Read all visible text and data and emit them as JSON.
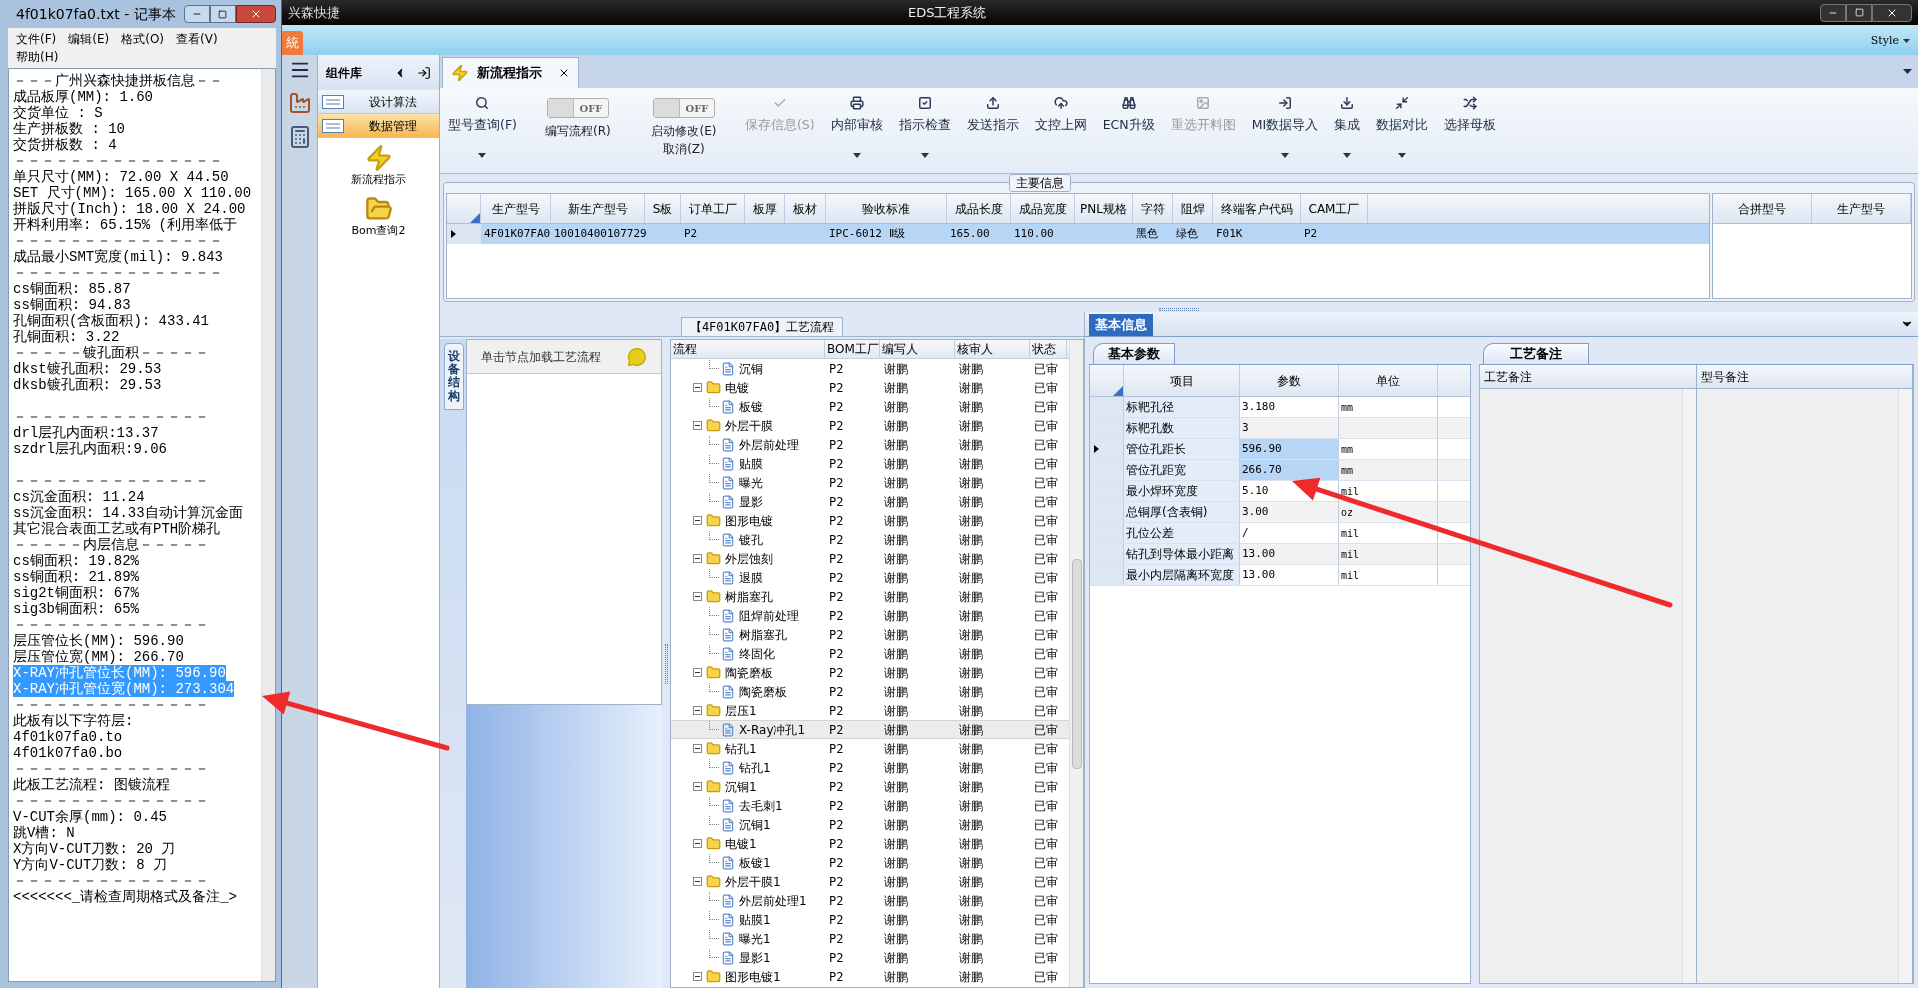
{
  "notepad": {
    "title": "4f01k07fa0.txt - 记事本",
    "menu": [
      "文件(F)",
      "编辑(E)",
      "格式(O)",
      "查看(V)",
      "帮助(H)"
    ],
    "lines": [
      {
        "kind": "text",
        "text": "－－－广州兴森快捷拼板信息－－",
        "selected": false
      },
      {
        "kind": "text",
        "text": "成品板厚(MM): 1.60",
        "selected": false
      },
      {
        "kind": "text",
        "text": "交货单位 : S",
        "selected": false
      },
      {
        "kind": "text",
        "text": "生产拼板数 : 10",
        "selected": false
      },
      {
        "kind": "text",
        "text": "交货拼板数 : 4",
        "selected": false
      },
      {
        "kind": "text",
        "text": "－－－－－－－－－－－－－－－",
        "selected": false
      },
      {
        "kind": "text",
        "text": "单只尺寸(MM): 72.00 X 44.50",
        "selected": false
      },
      {
        "kind": "text",
        "text": "SET 尺寸(MM): 165.00 X 110.00",
        "selected": false
      },
      {
        "kind": "text",
        "text": "拼版尺寸(Inch): 18.00 X 24.00",
        "selected": false
      },
      {
        "kind": "text",
        "text": "开料利用率: 65.15% (利用率低于",
        "selected": false
      },
      {
        "kind": "text",
        "text": "－－－－－－－－－－－－－－－",
        "selected": false
      },
      {
        "kind": "text",
        "text": "成品最小SMT宽度(mil): 9.843",
        "selected": false
      },
      {
        "kind": "text",
        "text": "－－－－－－－－－－－－－－－",
        "selected": false
      },
      {
        "kind": "text",
        "text": "cs铜面积: 85.87",
        "selected": false
      },
      {
        "kind": "text",
        "text": "ss铜面积: 94.83",
        "selected": false
      },
      {
        "kind": "text",
        "text": "孔铜面积(含板面积): 433.41",
        "selected": false
      },
      {
        "kind": "text",
        "text": "孔铜面积: 3.22",
        "selected": false
      },
      {
        "kind": "text",
        "text": "－－－－－镀孔面积－－－－－",
        "selected": false
      },
      {
        "kind": "text",
        "text": "dkst镀孔面积: 29.53",
        "selected": false
      },
      {
        "kind": "text",
        "text": "dksb镀孔面积: 29.53",
        "selected": false
      },
      {
        "kind": "blank"
      },
      {
        "kind": "text",
        "text": "－－－－－－－－－－－－－－",
        "selected": false
      },
      {
        "kind": "text",
        "text": "drl层孔内面积:13.37",
        "selected": false
      },
      {
        "kind": "text",
        "text": "szdrl层孔内面积:9.06",
        "selected": false
      },
      {
        "kind": "blank"
      },
      {
        "kind": "text",
        "text": "－－－－－－－－－－－－－－",
        "selected": false
      },
      {
        "kind": "text",
        "text": "cs沉金面积: 11.24",
        "selected": false
      },
      {
        "kind": "text",
        "text": "ss沉金面积: 14.33自动计算沉金面",
        "selected": false
      },
      {
        "kind": "text",
        "text": "其它混合表面工艺或有PTH阶梯孔",
        "selected": false
      },
      {
        "kind": "text",
        "text": "－－－－－内层信息－－－－－",
        "selected": false
      },
      {
        "kind": "text",
        "text": "cs铜面积: 19.82%",
        "selected": false
      },
      {
        "kind": "text",
        "text": "ss铜面积: 21.89%",
        "selected": false
      },
      {
        "kind": "text",
        "text": "sig2t铜面积: 67%",
        "selected": false
      },
      {
        "kind": "text",
        "text": "sig3b铜面积: 65%",
        "selected": false
      },
      {
        "kind": "text",
        "text": "－－－－－－－－－－－－－－",
        "selected": false
      },
      {
        "kind": "text",
        "text": "层压管位长(MM): 596.90",
        "selected": false
      },
      {
        "kind": "text",
        "text": "层压管位宽(MM): 266.70",
        "selected": false
      },
      {
        "kind": "text",
        "text": "X-RAY冲孔管位长(MM): 596.90",
        "selected": true
      },
      {
        "kind": "text",
        "text": "X-RAY冲孔管位宽(MM): 273.304",
        "selected": true
      },
      {
        "kind": "text",
        "text": "－－－－－－－－－－－－－－",
        "selected": false
      },
      {
        "kind": "text",
        "text": "此板有以下字符层:",
        "selected": false
      },
      {
        "kind": "text",
        "text": "4f01k07fa0.to",
        "selected": false
      },
      {
        "kind": "text",
        "text": "4f01k07fa0.bo",
        "selected": false
      },
      {
        "kind": "text",
        "text": "－－－－－－－－－－－－－－",
        "selected": false
      },
      {
        "kind": "text",
        "text": "此板工艺流程: 图镀流程",
        "selected": false
      },
      {
        "kind": "text",
        "text": "－－－－－－－－－－－－－－",
        "selected": false
      },
      {
        "kind": "text",
        "text": "V-CUT余厚(mm): 0.45",
        "selected": false
      },
      {
        "kind": "text",
        "text": "跳V槽: N",
        "selected": false
      },
      {
        "kind": "text",
        "text": "X方向V-CUT刀数: 20 刀",
        "selected": false
      },
      {
        "kind": "text",
        "text": "Y方向V-CUT刀数: 8 刀",
        "selected": false
      },
      {
        "kind": "text",
        "text": "－－－－－－－－－－－－－－",
        "selected": false
      },
      {
        "kind": "text",
        "text": "<<<<<<<_请检查周期格式及备注_>",
        "selected": false
      }
    ]
  },
  "app": {
    "title_left": "兴森快捷",
    "title": "EDS工程系统",
    "ribbon_tab": "統",
    "style_menu": "Style"
  },
  "component_panel": {
    "title": "组件库",
    "groups": [
      {
        "label": "设计算法",
        "selected": false
      },
      {
        "label": "数据管理",
        "selected": true
      }
    ],
    "items": [
      "新流程指示",
      "Bom查询2"
    ]
  },
  "tabs": [
    {
      "label": "新流程指示",
      "selected": true
    }
  ],
  "toolbar": [
    {
      "kind": "button",
      "label": "型号查询(F)",
      "dropdown": true,
      "disabled": false
    },
    {
      "kind": "toggle",
      "label": "编写流程(R)",
      "state_text": "OFF",
      "on": false
    },
    {
      "kind": "toggle",
      "label": "启动修改(E) 取消(Z)",
      "state_text": "OFF",
      "on": false
    },
    {
      "kind": "button",
      "label": "保存信息(S)",
      "dropdown": false,
      "disabled": true
    },
    {
      "kind": "button",
      "label": "内部审核",
      "dropdown": true,
      "disabled": false
    },
    {
      "kind": "button",
      "label": "指示检查",
      "dropdown": true,
      "disabled": false
    },
    {
      "kind": "button",
      "label": "发送指示",
      "dropdown": false,
      "disabled": false
    },
    {
      "kind": "button",
      "label": "文控上网",
      "dropdown": false,
      "disabled": false
    },
    {
      "kind": "button",
      "label": "ECN升级",
      "dropdown": false,
      "disabled": false
    },
    {
      "kind": "button",
      "label": "重选开料图",
      "dropdown": false,
      "disabled": true
    },
    {
      "kind": "button",
      "label": "MI数据导入",
      "dropdown": true,
      "disabled": false
    },
    {
      "kind": "button",
      "label": "集成",
      "dropdown": true,
      "disabled": false
    },
    {
      "kind": "button",
      "label": "数据对比",
      "dropdown": true,
      "disabled": false
    },
    {
      "kind": "button",
      "label": "选择母板",
      "dropdown": false,
      "disabled": false
    }
  ],
  "main_info": {
    "title": "主要信息",
    "columns": [
      "生产型号",
      "新生产型号",
      "S板",
      "订单工厂",
      "板厚",
      "板材",
      "验收标准",
      "成品长度",
      "成品宽度",
      "PNL规格",
      "字符",
      "阻焊",
      "终端客户代码",
      "CAM工厂"
    ],
    "rows": [
      {
        "selected": true,
        "cells": [
          "4F01K07FA0",
          "10010400107729",
          null,
          "P2",
          null,
          null,
          "IPC-6012 Ⅱ级",
          "165.00",
          "110.00",
          null,
          "黑色",
          "绿色",
          "F01K",
          "P2"
        ]
      }
    ],
    "side_columns": [
      "合拼型号",
      "生产型号"
    ]
  },
  "process": {
    "title": "【4F01K07FA0】工艺流程",
    "side_tab": "设备结构",
    "hint": "单击节点加载工艺流程",
    "columns": [
      "流程",
      "BOM工厂",
      "编写人",
      "核审人",
      "状态"
    ],
    "tree": [
      {
        "children": [
          {
            "name": "沉铜",
            "kind": "file",
            "bom": "P2",
            "writer": "谢鹏",
            "reviewer": "谢鹏",
            "status": "已审",
            "selected": false
          }
        ]
      },
      {
        "name": "电镀",
        "kind": "folder",
        "expanded": true,
        "bom": "P2",
        "writer": "谢鹏",
        "reviewer": "谢鹏",
        "status": "已审",
        "selected": false,
        "children": [
          {
            "name": "板镀",
            "kind": "file",
            "bom": "P2",
            "writer": "谢鹏",
            "reviewer": "谢鹏",
            "status": "已审",
            "selected": false
          }
        ]
      },
      {
        "name": "外层干膜",
        "kind": "folder",
        "expanded": true,
        "bom": "P2",
        "writer": "谢鹏",
        "reviewer": "谢鹏",
        "status": "已审",
        "selected": false,
        "children": [
          {
            "name": "外层前处理",
            "kind": "file",
            "bom": "P2",
            "writer": "谢鹏",
            "reviewer": "谢鹏",
            "status": "已审",
            "selected": false
          },
          {
            "name": "贴膜",
            "kind": "file",
            "bom": "P2",
            "writer": "谢鹏",
            "reviewer": "谢鹏",
            "status": "已审",
            "selected": false
          },
          {
            "name": "曝光",
            "kind": "file",
            "bom": "P2",
            "writer": "谢鹏",
            "reviewer": "谢鹏",
            "status": "已审",
            "selected": false
          },
          {
            "name": "显影",
            "kind": "file",
            "bom": "P2",
            "writer": "谢鹏",
            "reviewer": "谢鹏",
            "status": "已审",
            "selected": false
          }
        ]
      },
      {
        "name": "图形电镀",
        "kind": "folder",
        "expanded": true,
        "bom": "P2",
        "writer": "谢鹏",
        "reviewer": "谢鹏",
        "status": "已审",
        "selected": false,
        "children": [
          {
            "name": "镀孔",
            "kind": "file",
            "bom": "P2",
            "writer": "谢鹏",
            "reviewer": "谢鹏",
            "status": "已审",
            "selected": false
          }
        ]
      },
      {
        "name": "外层蚀刻",
        "kind": "folder",
        "expanded": true,
        "bom": "P2",
        "writer": "谢鹏",
        "reviewer": "谢鹏",
        "status": "已审",
        "selected": false,
        "children": [
          {
            "name": "退膜",
            "kind": "file",
            "bom": "P2",
            "writer": "谢鹏",
            "reviewer": "谢鹏",
            "status": "已审",
            "selected": false
          }
        ]
      },
      {
        "name": "树脂塞孔",
        "kind": "folder",
        "expanded": true,
        "bom": "P2",
        "writer": "谢鹏",
        "reviewer": "谢鹏",
        "status": "已审",
        "selected": false,
        "children": [
          {
            "name": "阻焊前处理",
            "kind": "file",
            "bom": "P2",
            "writer": "谢鹏",
            "reviewer": "谢鹏",
            "status": "已审",
            "selected": false
          },
          {
            "name": "树脂塞孔",
            "kind": "file",
            "bom": "P2",
            "writer": "谢鹏",
            "reviewer": "谢鹏",
            "status": "已审",
            "selected": false
          },
          {
            "name": "终固化",
            "kind": "file",
            "bom": "P2",
            "writer": "谢鹏",
            "reviewer": "谢鹏",
            "status": "已审",
            "selected": false
          }
        ]
      },
      {
        "name": "陶瓷磨板",
        "kind": "folder",
        "expanded": true,
        "bom": "P2",
        "writer": "谢鹏",
        "reviewer": "谢鹏",
        "status": "已审",
        "selected": false,
        "children": [
          {
            "name": "陶瓷磨板",
            "kind": "file",
            "bom": "P2",
            "writer": "谢鹏",
            "reviewer": "谢鹏",
            "status": "已审",
            "selected": false
          }
        ]
      },
      {
        "name": "层压1",
        "kind": "folder",
        "expanded": true,
        "bom": "P2",
        "writer": "谢鹏",
        "reviewer": "谢鹏",
        "status": "已审",
        "selected": false,
        "children": [
          {
            "name": "X-Ray冲孔1",
            "kind": "file",
            "bom": "P2",
            "writer": "谢鹏",
            "reviewer": "谢鹏",
            "status": "已审",
            "selected": true
          }
        ]
      },
      {
        "name": "钻孔1",
        "kind": "folder",
        "expanded": true,
        "bom": "P2",
        "writer": "谢鹏",
        "reviewer": "谢鹏",
        "status": "已审",
        "selected": false,
        "children": [
          {
            "name": "钻孔1",
            "kind": "file",
            "bom": "P2",
            "writer": "谢鹏",
            "reviewer": "谢鹏",
            "status": "已审",
            "selected": false
          }
        ]
      },
      {
        "name": "沉铜1",
        "kind": "folder",
        "expanded": true,
        "bom": "P2",
        "writer": "谢鹏",
        "reviewer": "谢鹏",
        "status": "已审",
        "selected": false,
        "children": [
          {
            "name": "去毛刺1",
            "kind": "file",
            "bom": "P2",
            "writer": "谢鹏",
            "reviewer": "谢鹏",
            "status": "已审",
            "selected": false
          },
          {
            "name": "沉铜1",
            "kind": "file",
            "bom": "P2",
            "writer": "谢鹏",
            "reviewer": "谢鹏",
            "status": "已审",
            "selected": false
          }
        ]
      },
      {
        "name": "电镀1",
        "kind": "folder",
        "expanded": true,
        "bom": "P2",
        "writer": "谢鹏",
        "reviewer": "谢鹏",
        "status": "已审",
        "selected": false,
        "children": [
          {
            "name": "板镀1",
            "kind": "file",
            "bom": "P2",
            "writer": "谢鹏",
            "reviewer": "谢鹏",
            "status": "已审",
            "selected": false
          }
        ]
      },
      {
        "name": "外层干膜1",
        "kind": "folder",
        "expanded": true,
        "bom": "P2",
        "writer": "谢鹏",
        "reviewer": "谢鹏",
        "status": "已审",
        "selected": false,
        "children": [
          {
            "name": "外层前处理1",
            "kind": "file",
            "bom": "P2",
            "writer": "谢鹏",
            "reviewer": "谢鹏",
            "status": "已审",
            "selected": false
          },
          {
            "name": "贴膜1",
            "kind": "file",
            "bom": "P2",
            "writer": "谢鹏",
            "reviewer": "谢鹏",
            "status": "已审",
            "selected": false
          },
          {
            "name": "曝光1",
            "kind": "file",
            "bom": "P2",
            "writer": "谢鹏",
            "reviewer": "谢鹏",
            "status": "已审",
            "selected": false
          },
          {
            "name": "显影1",
            "kind": "file",
            "bom": "P2",
            "writer": "谢鹏",
            "reviewer": "谢鹏",
            "status": "已审",
            "selected": false
          }
        ]
      },
      {
        "name": "图形电镀1",
        "kind": "folder",
        "expanded": true,
        "bom": "P2",
        "writer": "谢鹏",
        "reviewer": "谢鹏",
        "status": "已审",
        "selected": false
      }
    ]
  },
  "basic_info": {
    "tab": "基本信息",
    "subtab": "基本参数",
    "columns": [
      "项目",
      "参数",
      "单位"
    ],
    "rows": [
      {
        "item": "标靶孔径",
        "value": "3.180",
        "unit": "mm",
        "current": false,
        "selected": false
      },
      {
        "item": "标靶孔数",
        "value": "3",
        "current": false,
        "selected": false
      },
      {
        "item": "管位孔距长",
        "value": "596.90",
        "unit": "mm",
        "current": true,
        "selected": true
      },
      {
        "item": "管位孔距宽",
        "value": "266.70",
        "unit": "mm",
        "current": false,
        "selected": true
      },
      {
        "item": "最小焊环宽度",
        "value": "5.10",
        "unit": "mil",
        "current": false,
        "selected": false
      },
      {
        "item": "总铜厚(含表铜)",
        "value": "3.00",
        "unit": "oz",
        "current": false,
        "selected": false
      },
      {
        "item": "孔位公差",
        "value": "/",
        "unit": "mil",
        "current": false,
        "selected": false
      },
      {
        "item": "钻孔到导体最小距离",
        "value": "13.00",
        "unit": "mil",
        "current": false,
        "selected": false
      },
      {
        "item": "最小内层隔离环宽度",
        "value": "13.00",
        "unit": "mil",
        "current": false,
        "selected": false
      }
    ]
  },
  "remarks": {
    "tab": "工艺备注",
    "columns": [
      "工艺备注",
      "型号备注"
    ]
  }
}
